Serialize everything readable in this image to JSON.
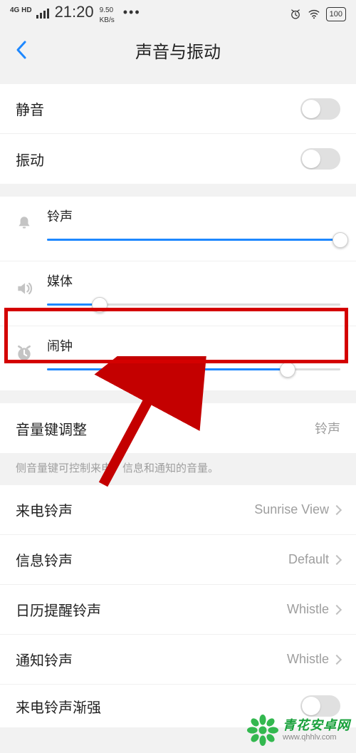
{
  "status": {
    "net": "4G HD",
    "time": "21:20",
    "speed_top": "9.50",
    "speed_bot": "KB/s",
    "dots": "•••",
    "battery": "100"
  },
  "header": {
    "title": "声音与振动"
  },
  "toggles": {
    "mute_label": "静音",
    "vibrate_label": "振动"
  },
  "sliders": {
    "ringtone": {
      "label": "铃声",
      "value": 100
    },
    "media": {
      "label": "媒体",
      "value": 18
    },
    "alarm": {
      "label": "闹钟",
      "value": 82
    }
  },
  "volkey": {
    "label": "音量键调整",
    "value": "铃声",
    "desc": "侧音量键可控制来电、信息和通知的音量。"
  },
  "ringtones": {
    "incoming": {
      "label": "来电铃声",
      "value": "Sunrise View"
    },
    "message": {
      "label": "信息铃声",
      "value": "Default"
    },
    "calendar": {
      "label": "日历提醒铃声",
      "value": "Whistle"
    },
    "notify": {
      "label": "通知铃声",
      "value": "Whistle"
    },
    "fadein": {
      "label": "来电铃声渐强"
    }
  },
  "watermark": {
    "main": "青花安卓网",
    "sub": "www.qhhlv.com"
  }
}
